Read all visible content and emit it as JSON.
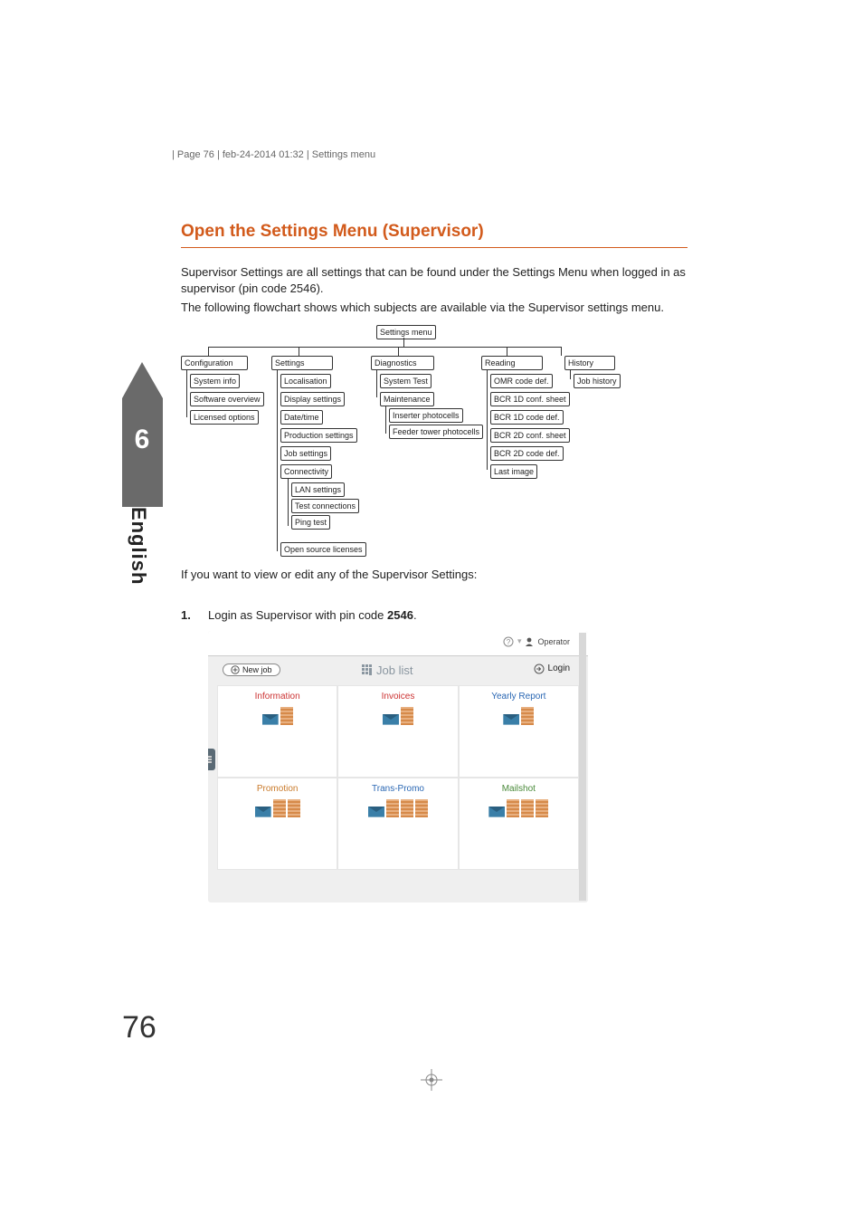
{
  "header": {
    "text": "| Page 76 | feb-24-2014 01:32 | Settings menu"
  },
  "title": "Open the Settings Menu (Supervisor)",
  "para1": "Supervisor Settings are all settings that can be found under the Settings Menu when logged in as supervisor (pin code 2546).",
  "para2": "The following flowchart shows which subjects are available via the Supervisor settings menu.",
  "after_flow": "If you want to view or edit any of the Supervisor Settings:",
  "step": {
    "num": "1.",
    "text_prefix": "Login as Supervisor with pin code ",
    "code": "2546",
    "suffix": "."
  },
  "sidebar": {
    "chapter": "6",
    "lang": "English"
  },
  "flow": {
    "root": "Settings menu",
    "cols": [
      {
        "head": "Configuration",
        "items": [
          "System info",
          "Software overview",
          "Licensed options"
        ]
      },
      {
        "head": "Settings",
        "items": [
          "Localisation",
          "Display settings",
          "Date/time",
          "Production settings",
          "Job settings",
          "Connectivity",
          "LAN settings",
          "Test connections",
          "Ping test",
          "Open source licenses"
        ]
      },
      {
        "head": "Diagnostics",
        "items": [
          "System Test",
          "Maintenance",
          "Inserter photocells",
          "Feeder tower photocells"
        ]
      },
      {
        "head": "Reading",
        "items": [
          "OMR code def.",
          "BCR 1D conf. sheet",
          "BCR 1D code def.",
          "BCR 2D conf. sheet",
          "BCR 2D code def.",
          "Last image"
        ]
      },
      {
        "head": "History",
        "items": [
          "Job history"
        ]
      }
    ]
  },
  "shot": {
    "new_job": "New job",
    "job_list": "Job list",
    "operator": "Operator",
    "login": "Login",
    "tiles": [
      {
        "name": "Information",
        "cls": "c-red"
      },
      {
        "name": "Invoices",
        "cls": "c-red"
      },
      {
        "name": "Yearly Report",
        "cls": "c-blue"
      },
      {
        "name": "Promotion",
        "cls": "c-orange"
      },
      {
        "name": "Trans-Promo",
        "cls": "c-blue"
      },
      {
        "name": "Mailshot",
        "cls": "c-green"
      }
    ]
  },
  "page_number": "76"
}
